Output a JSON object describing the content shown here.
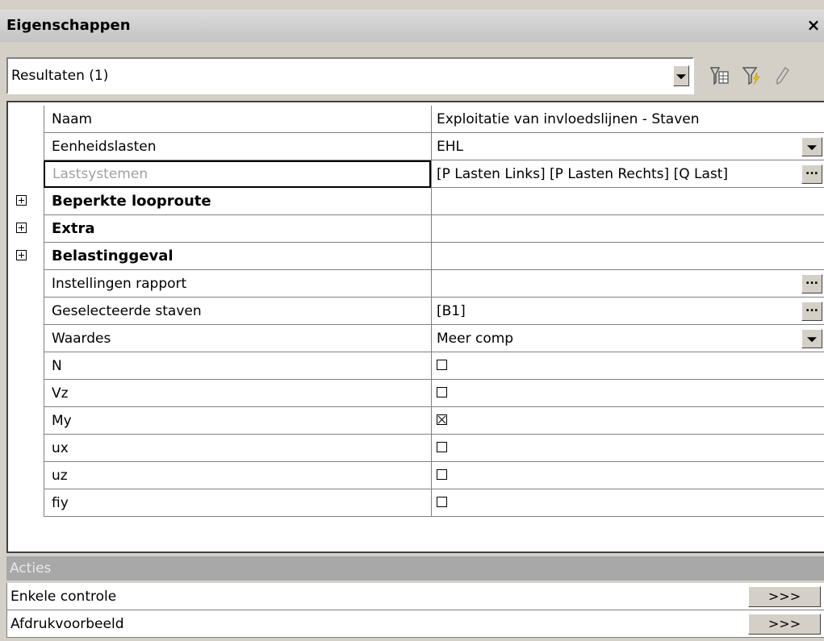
{
  "window": {
    "title": "Eigenschappen",
    "close_glyph": "×"
  },
  "selector": {
    "value": "Resultaten (1)"
  },
  "toolbar_icons": [
    "filter-table-icon",
    "filter-flash-icon",
    "pencil-icon"
  ],
  "grid": {
    "rows": [
      {
        "name": "Naam",
        "value": "Exploitatie van invloedslijnen - Staven",
        "type": "text"
      },
      {
        "name": "Eenheidslasten",
        "value": "EHL",
        "type": "dropdown"
      },
      {
        "name": "Lastsystemen",
        "value": "[P Lasten Links] [P Lasten Rechts] [Q Last]",
        "type": "ellipsis",
        "disabled": true
      },
      {
        "name": "Beperkte looproute",
        "value": "",
        "type": "group"
      },
      {
        "name": "Extra",
        "value": "",
        "type": "group"
      },
      {
        "name": "Belastinggeval",
        "value": "",
        "type": "group"
      },
      {
        "name": "Instellingen rapport",
        "value": "",
        "type": "ellipsis"
      },
      {
        "name": "Geselecteerde staven",
        "value": "[B1]",
        "type": "ellipsis"
      },
      {
        "name": "Waardes",
        "value": "Meer comp",
        "type": "dropdown"
      },
      {
        "name": "N",
        "checked": false,
        "type": "checkbox"
      },
      {
        "name": "Vz",
        "checked": false,
        "type": "checkbox"
      },
      {
        "name": "My",
        "checked": true,
        "type": "checkbox"
      },
      {
        "name": "ux",
        "checked": false,
        "type": "checkbox"
      },
      {
        "name": "uz",
        "checked": false,
        "type": "checkbox"
      },
      {
        "name": "fiy",
        "checked": false,
        "type": "checkbox"
      }
    ]
  },
  "actions": {
    "header": "Acties",
    "items": [
      {
        "label": "Enkele controle",
        "button": ">>>"
      },
      {
        "label": "Afdrukvoorbeeld",
        "button": ">>>"
      }
    ]
  }
}
